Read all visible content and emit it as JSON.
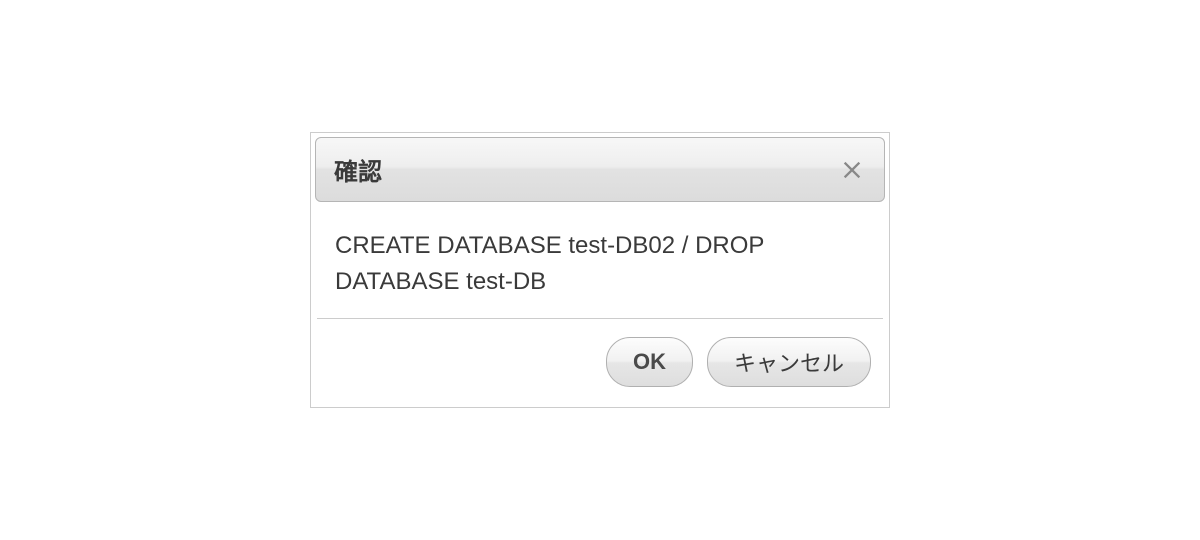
{
  "dialog": {
    "title": "確認",
    "message": "CREATE DATABASE test-DB02 / DROP DATABASE test-DB",
    "ok_label": "OK",
    "cancel_label": "キャンセル"
  }
}
